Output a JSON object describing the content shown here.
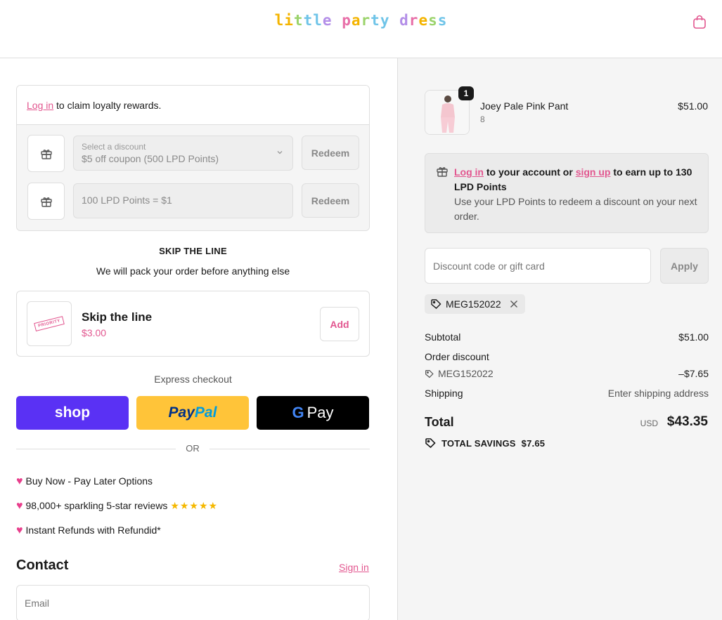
{
  "header": {
    "brand": "little party dress",
    "brand_colors": [
      "#f4b400",
      "#f4b400",
      "#9bd36b",
      "#6fc4e8",
      "#6fc4e8",
      "#b38ee8",
      "#e86fa8",
      "#f4b400",
      "#9bd36b",
      "#6fc4e8",
      "#6fc4e8",
      "#b38ee8",
      "#e86fa8",
      "#f4b400",
      "#9bd36b",
      "#6fc4e8",
      "#b38ee8",
      "#e86fa8"
    ],
    "cart_icon": "shopping-bag-icon"
  },
  "loyalty": {
    "login_link": "Log in",
    "login_text": " to claim loyalty rewards.",
    "discount_select": {
      "label": "Select a discount",
      "value": "$5 off coupon (500 LPD Points)"
    },
    "points_placeholder": "100 LPD Points = $1",
    "redeem_label": "Redeem"
  },
  "skip_line": {
    "title": "SKIP THE LINE",
    "subtitle": "We will pack your order before anything else",
    "stamp_text": "PRIORITY",
    "product_name": "Skip the line",
    "price": "$3.00",
    "add_label": "Add"
  },
  "express": {
    "label": "Express checkout",
    "shop_label": "shop",
    "paypal_label_1": "Pay",
    "paypal_label_2": "Pal",
    "gpay_label": "Pay",
    "or_label": "OR"
  },
  "perks": [
    {
      "text": "Buy Now - Pay Later Options"
    },
    {
      "text": "98,000+ sparkling 5-star reviews",
      "stars": "★★★★★"
    },
    {
      "text": "Instant Refunds with Refundid*"
    }
  ],
  "contact": {
    "title": "Contact",
    "sign_in": "Sign in",
    "email_placeholder": "Email"
  },
  "order": {
    "quantity": "1",
    "product_name": "Joey Pale Pink Pant",
    "variant": "8",
    "price": "$51.00",
    "earn": {
      "login": "Log in",
      "text1": " to your account or ",
      "signup": "sign up",
      "text2": " to earn up to 130 LPD Points",
      "detail": "Use your LPD Points to redeem a discount on your next order."
    },
    "discount_placeholder": "Discount code or gift card",
    "apply_label": "Apply",
    "applied_code": "MEG152022",
    "subtotal_label": "Subtotal",
    "subtotal": "$51.00",
    "order_discount_label": "Order discount",
    "discount_code": "MEG152022",
    "discount_amount": "–$7.65",
    "shipping_label": "Shipping",
    "shipping_value": "Enter shipping address",
    "total_label": "Total",
    "currency": "USD",
    "total": "$43.35",
    "savings_label": "TOTAL SAVINGS",
    "savings": "$7.65"
  }
}
